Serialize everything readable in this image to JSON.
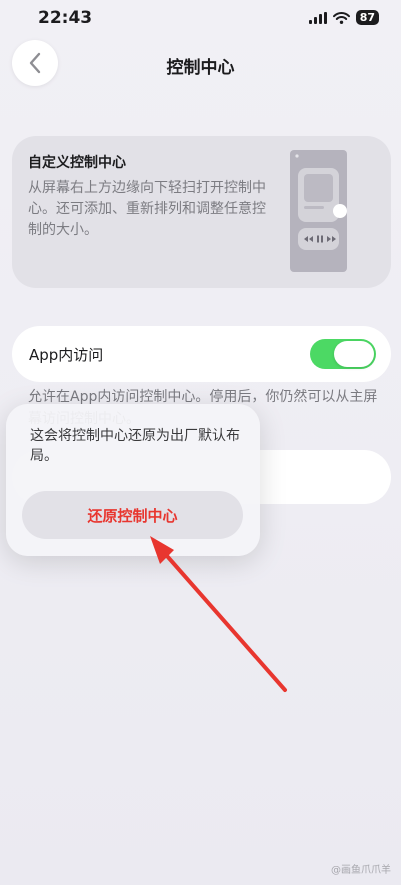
{
  "status_bar": {
    "time": "22:43",
    "battery": "87"
  },
  "nav": {
    "title": "控制中心"
  },
  "custom_card": {
    "title": "自定义控制中心",
    "description": "从屏幕右上方边缘向下轻扫打开控制中心。还可添加、重新排列和调整任意控制的大小。"
  },
  "app_access": {
    "label": "App内访问",
    "enabled": true
  },
  "footnote": "允许在App内访问控制中心。停用后，你仍然可以从主屏幕访问控制中心。",
  "popup": {
    "message": "这会将控制中心还原为出厂默认布局。",
    "button_label": "还原控制中心"
  },
  "watermark": "@画鱼爪爪羊",
  "colors": {
    "toggle_on": "#4cd964",
    "destructive": "#e8362f",
    "arrow": "#e8362f"
  }
}
